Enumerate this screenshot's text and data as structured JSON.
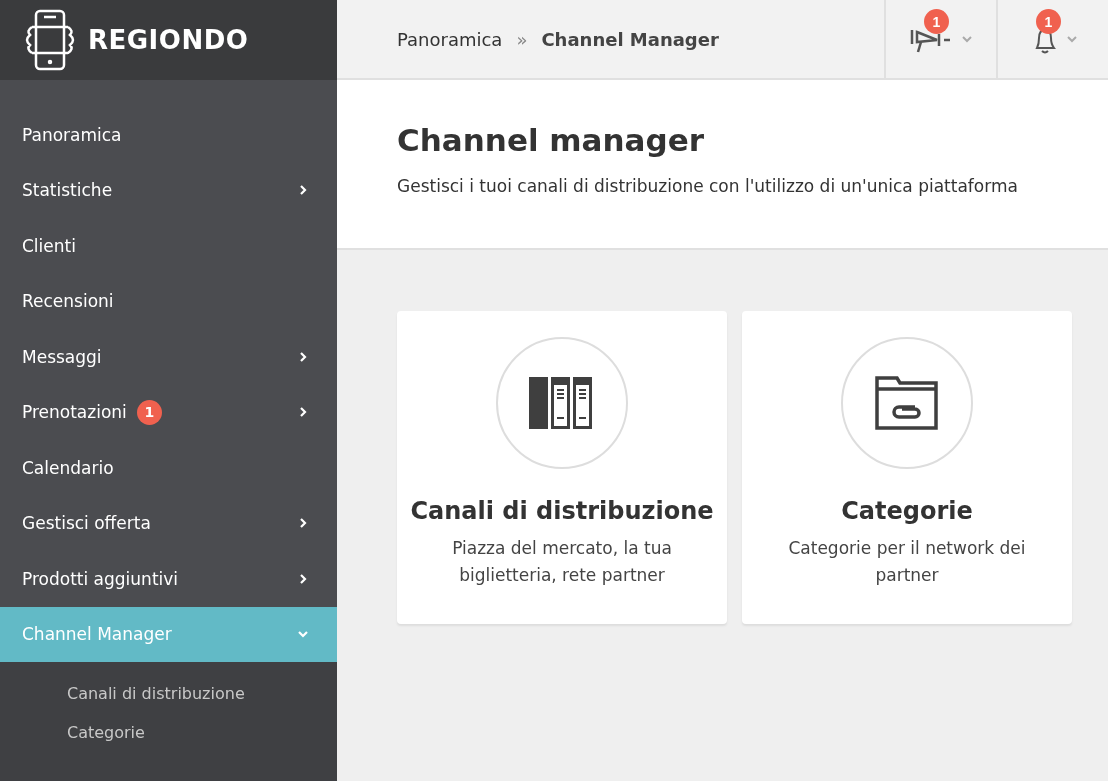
{
  "brand": {
    "name": "REGIONDO"
  },
  "breadcrumb": [
    {
      "label": "Panoramica",
      "current": false
    },
    {
      "label": "Channel Manager",
      "current": true
    }
  ],
  "breadcrumb_separator": "»",
  "header_buttons": [
    {
      "kind": "megaphone",
      "badge": "1"
    },
    {
      "kind": "bell",
      "badge": "1"
    }
  ],
  "sidebar": {
    "items": [
      {
        "label": "Panoramica",
        "selected": false
      },
      {
        "label": "Statistiche",
        "selected": false,
        "expanded": false
      },
      {
        "label": "Clienti",
        "selected": false
      },
      {
        "label": "Recensioni",
        "selected": false
      },
      {
        "label": "Messaggi",
        "selected": false,
        "expanded": false
      },
      {
        "label": "Prenotazioni",
        "selected": false,
        "expanded": false,
        "badge": "1"
      },
      {
        "label": "Calendario",
        "selected": false
      },
      {
        "label": "Gestisci offerta",
        "selected": false,
        "expanded": false
      },
      {
        "label": "Prodotti aggiuntivi",
        "selected": false,
        "expanded": false
      },
      {
        "label": "Channel Manager",
        "selected": true,
        "expanded": true,
        "children": [
          {
            "label": "Canali di distribuzione"
          },
          {
            "label": "Categorie"
          }
        ]
      }
    ]
  },
  "page": {
    "title": "Channel manager",
    "subtitle": "Gestisci i tuoi canali di distribuzione con l'utilizzo di un'unica piattaforma"
  },
  "cards": [
    {
      "kind": "binders",
      "title": "Canali di distribuzione",
      "description": "Piazza del mercato, la tua biglietteria, rete partner"
    },
    {
      "kind": "folder",
      "title": "Categorie",
      "description": "Categorie per il network dei partner"
    }
  ]
}
